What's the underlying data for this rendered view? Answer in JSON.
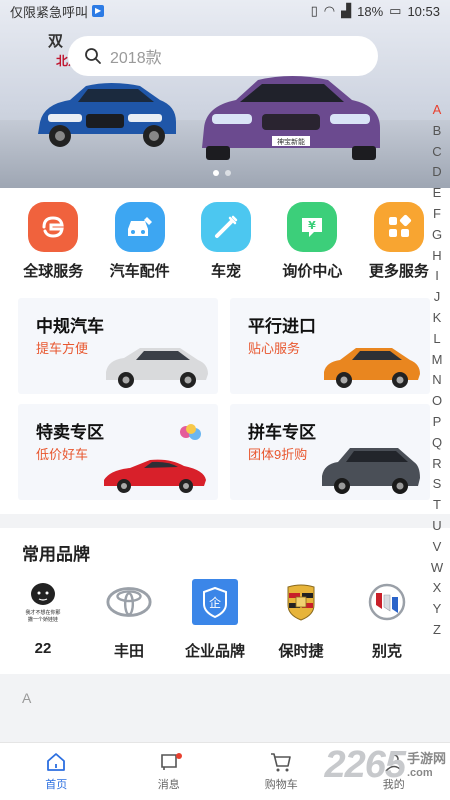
{
  "status_bar": {
    "left_text": "仅限紧急呼叫",
    "battery": "18%",
    "time": "10:53"
  },
  "banner": {
    "brand_text_1": "双",
    "brand_text_2": "北京",
    "plate_text": "神宝新能",
    "slide_count": 2,
    "active_slide": 0
  },
  "search": {
    "placeholder": "2018款"
  },
  "quick_actions": [
    {
      "label": "全球服务",
      "icon": "global-service-icon",
      "color": "#f0623d"
    },
    {
      "label": "汽车配件",
      "icon": "car-parts-icon",
      "color": "#3da6f2"
    },
    {
      "label": "车宠",
      "icon": "car-pet-icon",
      "color": "#4cc7f0"
    },
    {
      "label": "询价中心",
      "icon": "inquiry-icon",
      "color": "#3ccf7a"
    },
    {
      "label": "更多服务",
      "icon": "more-services-icon",
      "color": "#f8a531"
    }
  ],
  "cards": [
    {
      "title": "中规汽车",
      "subtitle": "提车方便",
      "car_color": "#d9dadc"
    },
    {
      "title": "平行进口",
      "subtitle": "贴心服务",
      "car_color": "#e9861f"
    },
    {
      "title": "特卖专区",
      "subtitle": "低价好车",
      "car_color": "#d8202a"
    },
    {
      "title": "拼车专区",
      "subtitle": "团体9折购",
      "car_color": "#4a4f57"
    }
  ],
  "brands": {
    "title": "常用品牌",
    "items": [
      {
        "name": "22",
        "logo": "meme-face-logo",
        "logo_text": [
          "我才不想在你那",
          "撒一个娇娃娃"
        ]
      },
      {
        "name": "丰田",
        "logo": "toyota-logo"
      },
      {
        "name": "企业品牌",
        "logo": "enterprise-logo",
        "logo_text": [
          "企"
        ]
      },
      {
        "name": "保时捷",
        "logo": "porsche-logo"
      },
      {
        "name": "别克",
        "logo": "buick-logo"
      }
    ]
  },
  "index_letters": [
    "A",
    "B",
    "C",
    "D",
    "E",
    "F",
    "G",
    "H",
    "I",
    "J",
    "K",
    "L",
    "M",
    "N",
    "O",
    "P",
    "Q",
    "R",
    "S",
    "T",
    "U",
    "V",
    "W",
    "X",
    "Y",
    "Z"
  ],
  "current_letter": "A",
  "section_letter": "A",
  "bottom_nav": [
    {
      "label": "首页",
      "icon": "home-icon",
      "active": true
    },
    {
      "label": "消息",
      "icon": "message-icon",
      "active": false
    },
    {
      "label": "购物车",
      "icon": "cart-icon",
      "active": false
    },
    {
      "label": "我的",
      "icon": "profile-icon",
      "active": false
    }
  ],
  "watermark": {
    "big": "2265",
    "small": "手游网",
    "suffix": ".com"
  }
}
